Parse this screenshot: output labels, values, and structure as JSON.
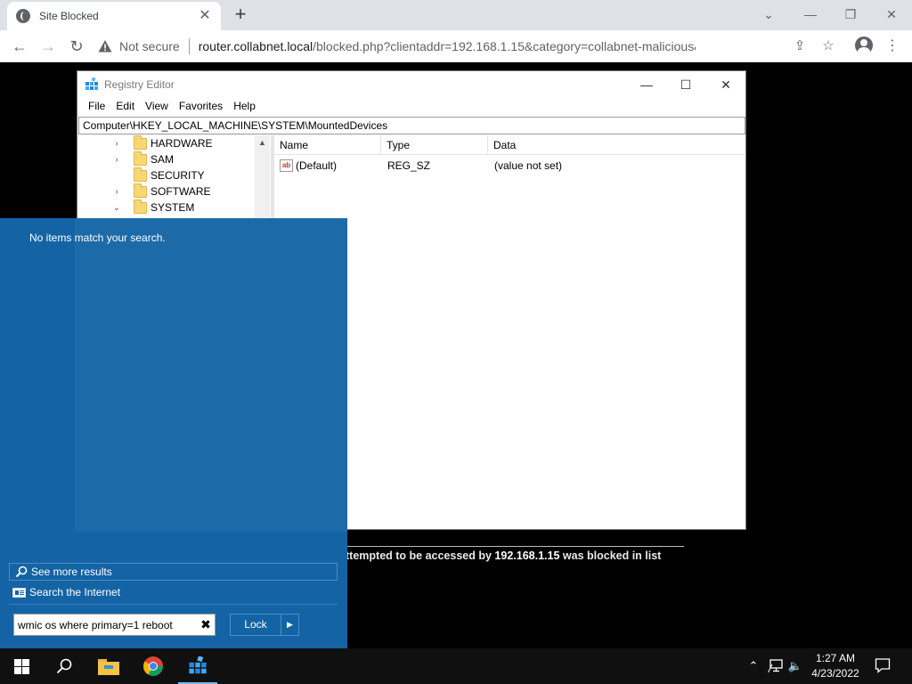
{
  "browser": {
    "tab_title": "Site Blocked",
    "tab_close": "✕",
    "new_tab": "+",
    "not_secure": "Not secure",
    "url_host": "router.collabnet.local",
    "url_rest": "/blocked.php?clientaddr=192.168.1.15&category=collabnet-malicious&url=github....",
    "window_controls": {
      "tab_search": "⌄",
      "minimize": "—",
      "restore": "❐",
      "close": "✕"
    },
    "nav": {
      "back": "←",
      "forward": "→",
      "reload": "↻"
    },
    "toolbar_icons": {
      "share": "⇪",
      "bookmark": "☆",
      "menu": "⋮"
    }
  },
  "blocked_page": {
    "message_prefix": "ttempted to be accessed by ",
    "client_ip": "192.168.1.15",
    "message_suffix": " was blocked in list"
  },
  "regedit": {
    "title": "Registry Editor",
    "window_controls": {
      "minimize": "—",
      "maximize": "☐",
      "close": "✕"
    },
    "menu": [
      "File",
      "Edit",
      "View",
      "Favorites",
      "Help"
    ],
    "address": "Computer\\HKEY_LOCAL_MACHINE\\SYSTEM\\MountedDevices",
    "tree": [
      {
        "label": "HARDWARE",
        "chevron": "›"
      },
      {
        "label": "SAM",
        "chevron": "›"
      },
      {
        "label": "SECURITY",
        "chevron": ""
      },
      {
        "label": "SOFTWARE",
        "chevron": "›"
      },
      {
        "label": "SYSTEM",
        "chevron": "⌄"
      }
    ],
    "columns": [
      "Name",
      "Type",
      "Data"
    ],
    "rows": [
      {
        "icon": "ab",
        "name": "(Default)",
        "type": "REG_SZ",
        "data": "(value not set)"
      }
    ]
  },
  "start_panel": {
    "no_items": "No items match your search.",
    "see_more": "See more results",
    "search_internet": "Search the Internet",
    "search_value": "wmic os where primary=1 reboot",
    "clear": "✖",
    "lock_label": "Lock",
    "lock_arrow": "▶"
  },
  "taskbar": {
    "tray": {
      "chevron": "⌃",
      "volume": "🔈"
    },
    "time": "1:27 AM",
    "date": "4/23/2022"
  },
  "colors": {
    "start_panel_bg": "#1464a5",
    "taskbar_bg": "#101010",
    "chrome_tabbar": "#dee1e6"
  }
}
